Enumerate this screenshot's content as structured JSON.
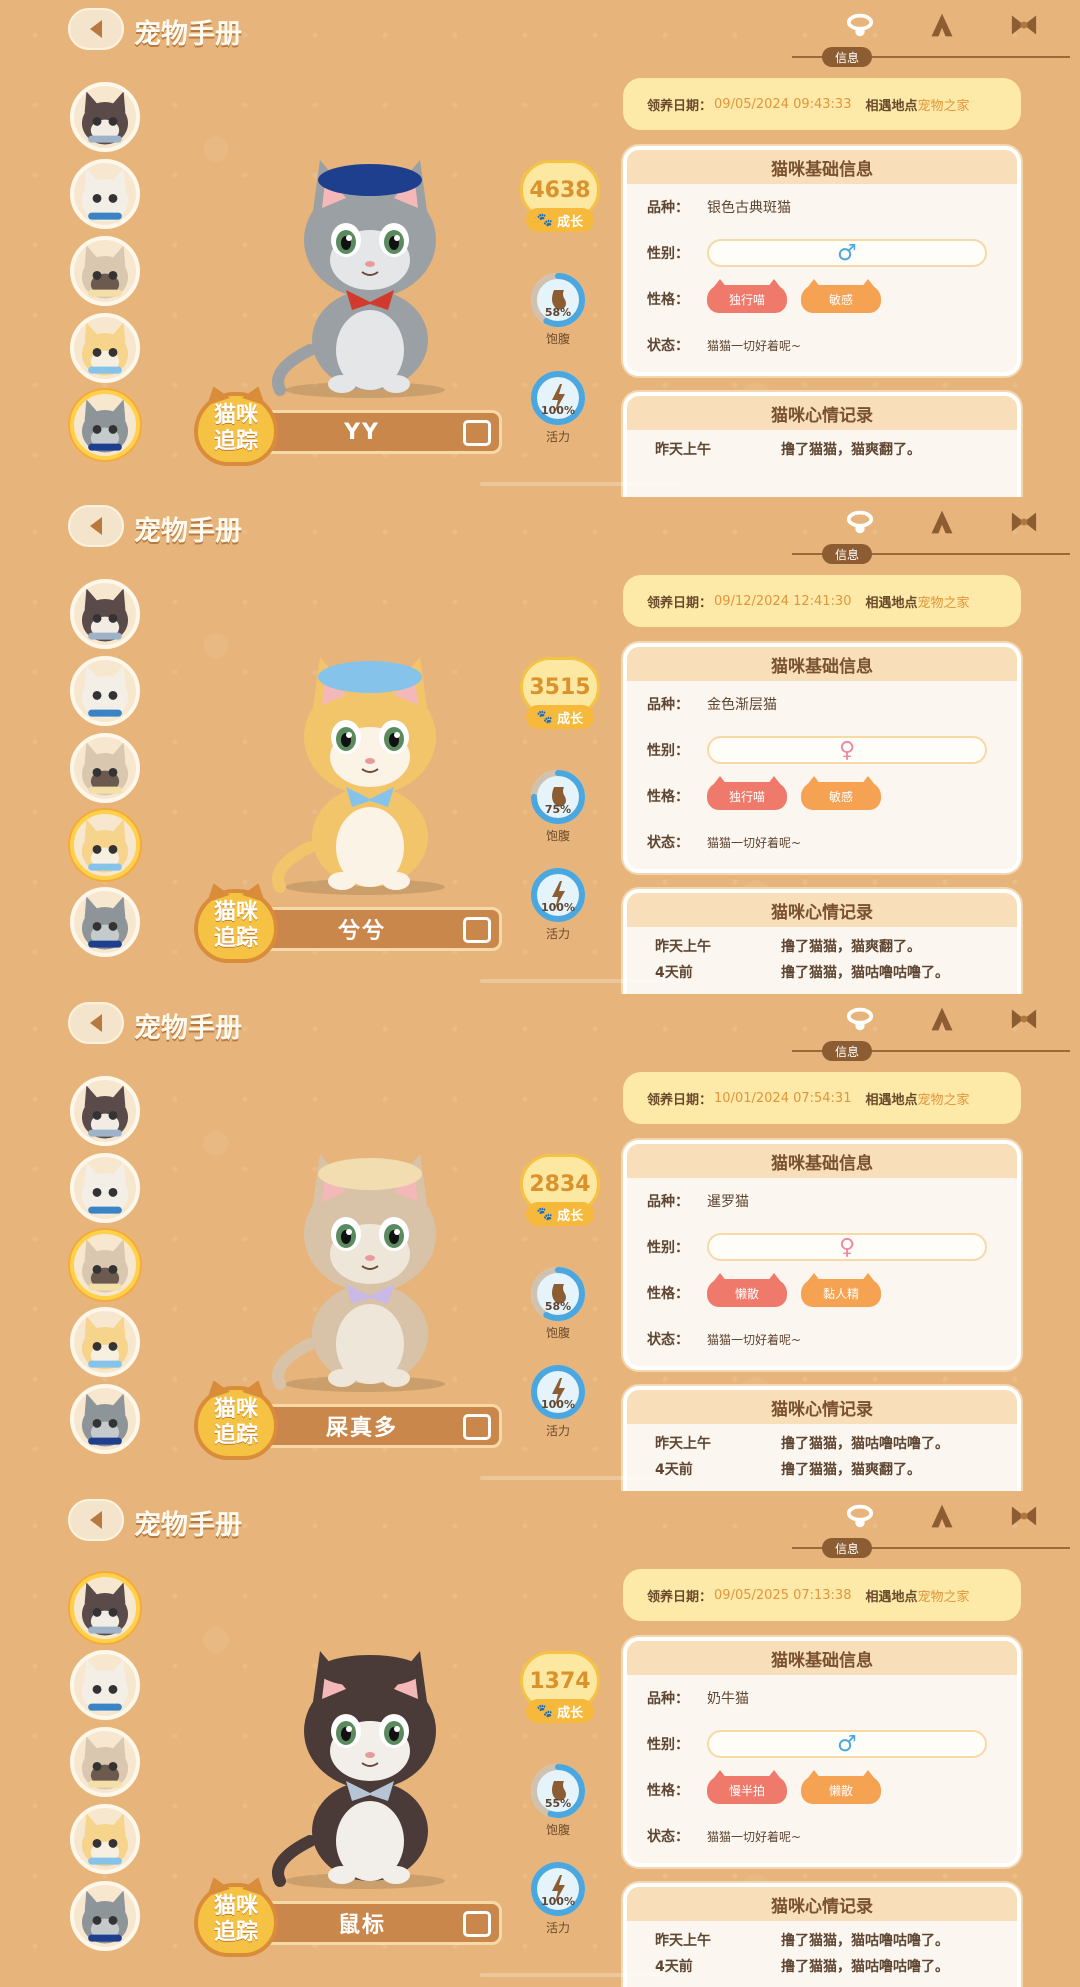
{
  "header": {
    "title": "宠物手册",
    "tab_info_label": "信息"
  },
  "colors": {
    "background": "#e7b57b",
    "accent_orange": "#e3953a",
    "badge_yellow": "#f6c243",
    "male_blue": "#4aa7e0",
    "female_pink": "#ee8aa6"
  },
  "labels": {
    "adopt_date": "领养日期",
    "meet_place": "相遇地点",
    "basic_info_title": "猫咪基础信息",
    "breed": "品种",
    "gender": "性别",
    "personality": "性格",
    "status": "状态",
    "mood_title": "猫咪心情记录",
    "growth": "成长",
    "satiety": "饱腹",
    "energy": "活力",
    "track_line1": "猫咪",
    "track_line2": "追踪"
  },
  "cats": [
    {
      "name": "YY",
      "growth": "4638",
      "satiety": "58%",
      "satiety_value": 0.58,
      "energy": "100%",
      "energy_value": 1.0,
      "adopt_date": "09/05/2024 09:43:33",
      "place": "宠物之家",
      "breed": "银色古典斑猫",
      "gender_symbol": "♂",
      "gender": "male",
      "traits": [
        "独行喵",
        "敏感"
      ],
      "status": "猫猫一切好着呢~",
      "moods": [
        {
          "time": "昨天上午",
          "text": "撸了猫猫，猫爽翻了。"
        }
      ],
      "selected_avatar": 4
    },
    {
      "name": "兮兮",
      "growth": "3515",
      "satiety": "75%",
      "satiety_value": 0.75,
      "energy": "100%",
      "energy_value": 1.0,
      "adopt_date": "09/12/2024 12:41:30",
      "place": "宠物之家",
      "breed": "金色渐层猫",
      "gender_symbol": "♀",
      "gender": "female",
      "traits": [
        "独行喵",
        "敏感"
      ],
      "status": "猫猫一切好着呢~",
      "moods": [
        {
          "time": "昨天上午",
          "text": "撸了猫猫，猫爽翻了。"
        },
        {
          "time": "4天前",
          "text": "撸了猫猫，猫咕噜咕噜了。"
        }
      ],
      "selected_avatar": 3
    },
    {
      "name": "屎真多",
      "growth": "2834",
      "satiety": "58%",
      "satiety_value": 0.58,
      "energy": "100%",
      "energy_value": 1.0,
      "adopt_date": "10/01/2024 07:54:31",
      "place": "宠物之家",
      "breed": "暹罗猫",
      "gender_symbol": "♀",
      "gender": "female",
      "traits": [
        "懒散",
        "黏人精"
      ],
      "status": "猫猫一切好着呢~",
      "moods": [
        {
          "time": "昨天上午",
          "text": "撸了猫猫，猫咕噜咕噜了。"
        },
        {
          "time": "4天前",
          "text": "撸了猫猫，猫爽翻了。"
        }
      ],
      "selected_avatar": 2
    },
    {
      "name": "鼠标",
      "growth": "1374",
      "satiety": "55%",
      "satiety_value": 0.55,
      "energy": "100%",
      "energy_value": 1.0,
      "adopt_date": "09/05/2025 07:13:38",
      "place": "宠物之家",
      "breed": "奶牛猫",
      "gender_symbol": "♂",
      "gender": "male",
      "traits": [
        "慢半拍",
        "懒散"
      ],
      "status": "猫猫一切好着呢~",
      "moods": [
        {
          "time": "昨天上午",
          "text": "撸了猫猫，猫咕噜咕噜了。"
        },
        {
          "time": "4天前",
          "text": "撸了猫猫，猫咕噜咕噜了。"
        }
      ],
      "selected_avatar": 0
    }
  ]
}
